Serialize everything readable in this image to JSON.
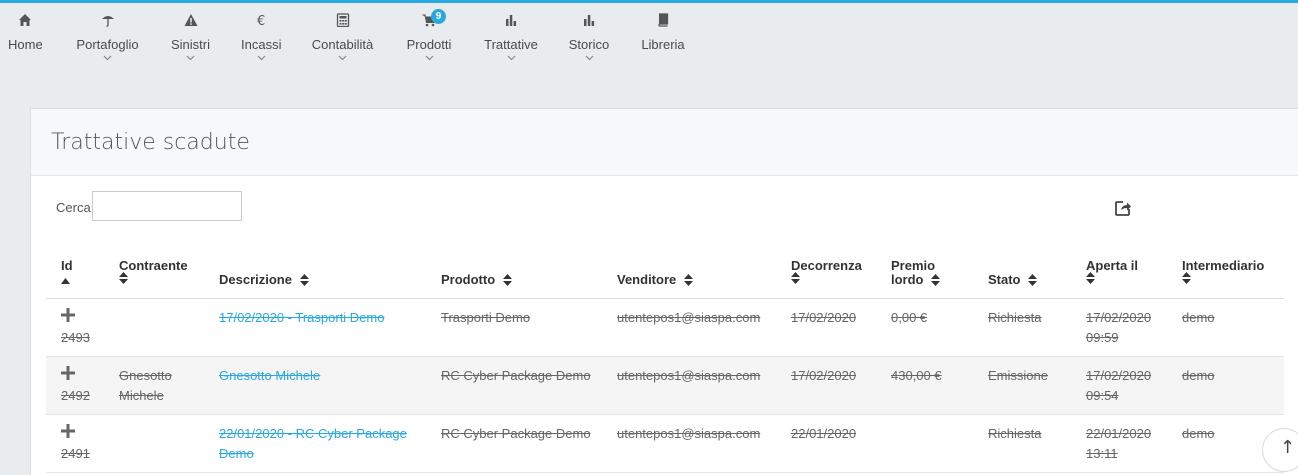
{
  "nav": {
    "items": [
      {
        "label": "Home",
        "icon": "home-icon"
      },
      {
        "label": "Portafoglio",
        "icon": "umbrella-icon"
      },
      {
        "label": "Sinistri",
        "icon": "warning-icon"
      },
      {
        "label": "Incassi",
        "icon": "euro-icon"
      },
      {
        "label": "Contabilità",
        "icon": "calculator-icon"
      },
      {
        "label": "Prodotti",
        "icon": "cart-icon",
        "badge": "9"
      },
      {
        "label": "Trattative",
        "icon": "bar-chart-icon"
      },
      {
        "label": "Storico",
        "icon": "bar-chart-icon"
      },
      {
        "label": "Libreria",
        "icon": "book-icon"
      }
    ]
  },
  "panel": {
    "title": "Trattative scadute",
    "search_label": "Cerca",
    "search_value": "",
    "export_icon": "export-icon"
  },
  "table": {
    "headers": {
      "id": "Id",
      "contraente": "Contraente",
      "descrizione": "Descrizione",
      "prodotto": "Prodotto",
      "venditore": "Venditore",
      "decorrenza": "Decorrenza",
      "premio_1": "Premio",
      "premio_2": "lordo",
      "stato": "Stato",
      "aperta_il": "Aperta il",
      "intermediario": "Intermediario"
    },
    "rows": [
      {
        "id": "2493",
        "contraente_1": "",
        "contraente_2": "",
        "descrizione_1": "17/02/2020 - Trasporti Demo",
        "descrizione_2": "",
        "prodotto": "Trasporti Demo",
        "venditore": "utentepos1@siaspa.com",
        "decorrenza": "17/02/2020",
        "premio": "0,00 €",
        "stato": "Richiesta",
        "aperta_il_date": "17/02/2020",
        "aperta_il_time": "09:59",
        "intermediario": "demo"
      },
      {
        "id": "2492",
        "contraente_1": "Gnesotto",
        "contraente_2": "Michele",
        "descrizione_1": "Gnesotto Michele",
        "descrizione_2": "",
        "prodotto": "RC Cyber Package Demo",
        "venditore": "utentepos1@siaspa.com",
        "decorrenza": "17/02/2020",
        "premio": "430,00 €",
        "stato": "Emissione",
        "aperta_il_date": "17/02/2020",
        "aperta_il_time": "09:54",
        "intermediario": "demo"
      },
      {
        "id": "2491",
        "contraente_1": "",
        "contraente_2": "",
        "descrizione_1": "22/01/2020 - RC Cyber Package",
        "descrizione_2": "Demo",
        "prodotto": "RC Cyber Package Demo",
        "venditore": "utentepos1@siaspa.com",
        "decorrenza": "22/01/2020",
        "premio": "",
        "stato": "Richiesta",
        "aperta_il_date": "22/01/2020",
        "aperta_il_time": "13:11",
        "intermediario": "demo"
      }
    ]
  },
  "scroll_top_icon": "arrow-up-icon",
  "colors": {
    "accent": "#29a8e0",
    "background": "#e9ecee"
  }
}
